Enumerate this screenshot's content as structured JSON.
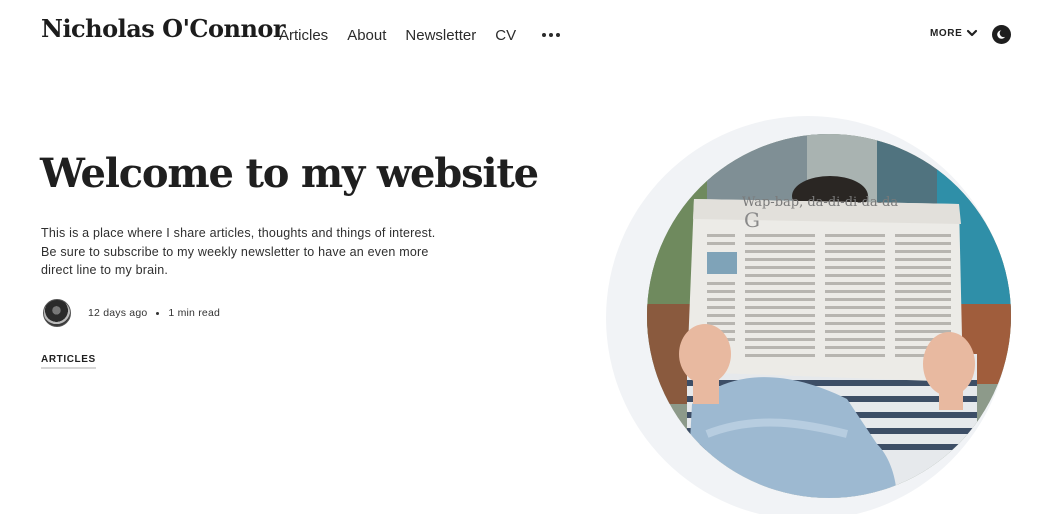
{
  "header": {
    "logo": "Nicholas O'Connor",
    "nav": [
      "Articles",
      "About",
      "Newsletter",
      "CV"
    ],
    "more_label": "MORE"
  },
  "hero": {
    "title": "Welcome to my website",
    "description": "This is a place where I share articles, thoughts and things of interest. Be sure to subscribe to my weekly newsletter to have an even more direct line to my brain.",
    "meta": {
      "date": "12 days ago",
      "read_time": "1 min read"
    },
    "tag": "ARTICLES",
    "newspaper_headline": "Wap-bap, da-di-di-da-da"
  },
  "colors": {
    "text": "#1f1f1f",
    "ring": "#f1f3f6",
    "background": "#ffffff"
  },
  "icons": [
    "more-dots-icon",
    "chevron-down-icon",
    "moon-icon",
    "author-avatar"
  ]
}
